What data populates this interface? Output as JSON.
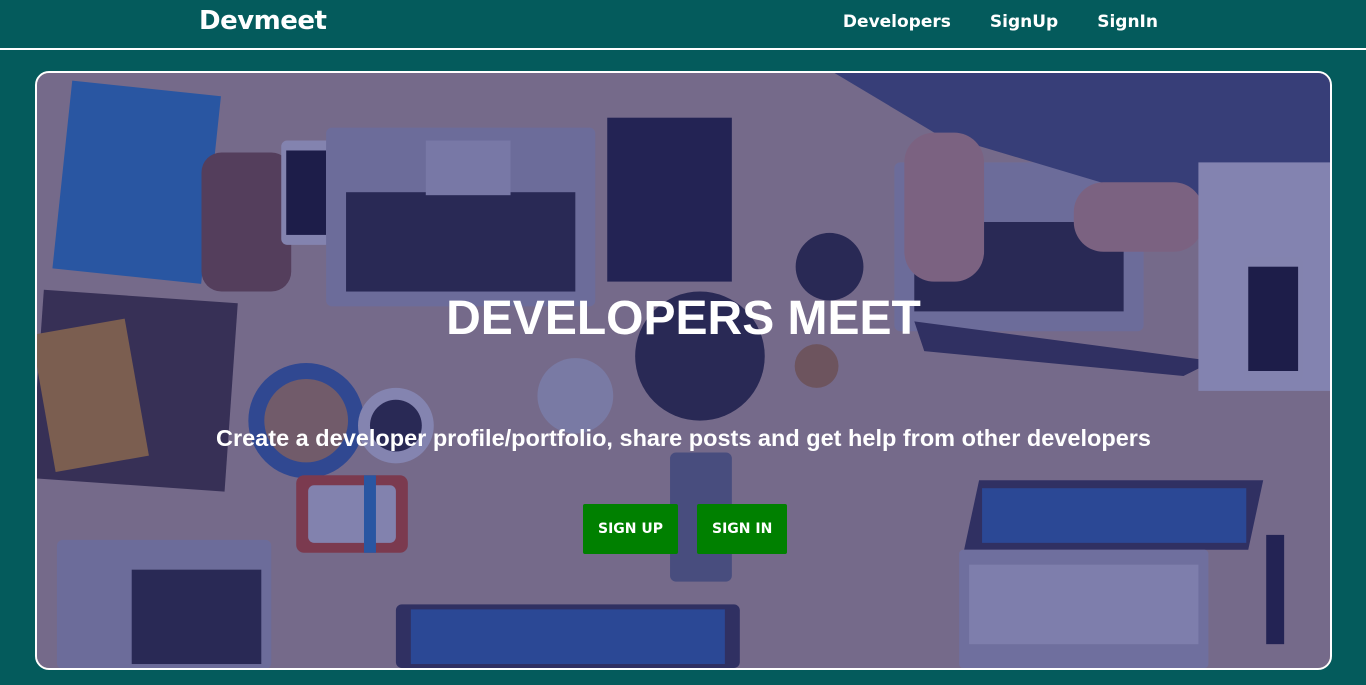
{
  "nav": {
    "brand": "Devmeet",
    "links": [
      "Developers",
      "SignUp",
      "SignIn"
    ]
  },
  "hero": {
    "title": "DEVELOPERS MEET",
    "subtitle": "Create a developer profile/portfolio, share posts and get help from other developers",
    "buttons": {
      "signup": "SIGN UP",
      "signin": "SIGN IN"
    },
    "background_image": "overhead-desk-with-laptops-photo"
  },
  "colors": {
    "page_bg": "#045b5c",
    "button_bg": "#008000",
    "text": "#ffffff",
    "overlay": "rgba(40,40,120,0.55)"
  }
}
